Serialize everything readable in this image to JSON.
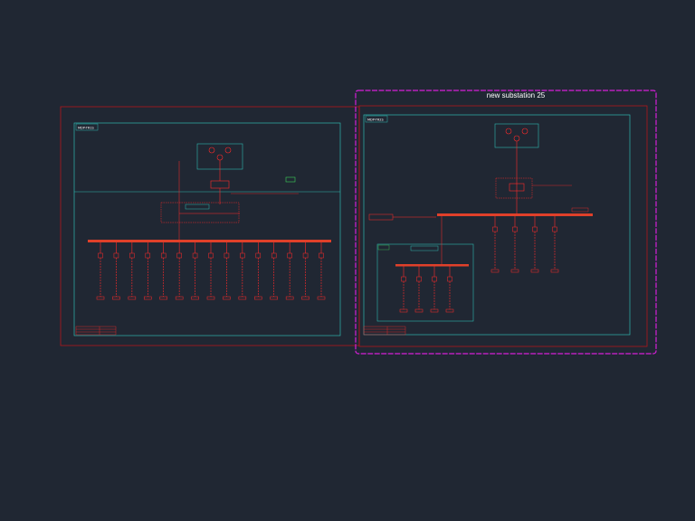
{
  "canvas": {
    "background": "#202733"
  },
  "colors": {
    "busbar": "#e0402a",
    "wire": "#ff2a2a",
    "frame_red": "#b3161b",
    "frame_cyan": "#2fb7b0",
    "selection": "#d51fd8",
    "annotation": "#ffffff",
    "accent_green": "#3fd05a",
    "accent_yellow": "#f0e04a"
  },
  "selection_title": "new substation 25",
  "left_sheet": {
    "tag": "MDP-TR1S",
    "feeder_count": 15
  },
  "right_sheet": {
    "tag": "MDP-TR2S",
    "main_feeder_count": 4,
    "sub_panel_feeder_count": 4
  },
  "icons": {
    "breaker": "breaker-icon",
    "transformer": "transformer-icon",
    "meter": "meter-icon",
    "ground": "ground-icon"
  }
}
